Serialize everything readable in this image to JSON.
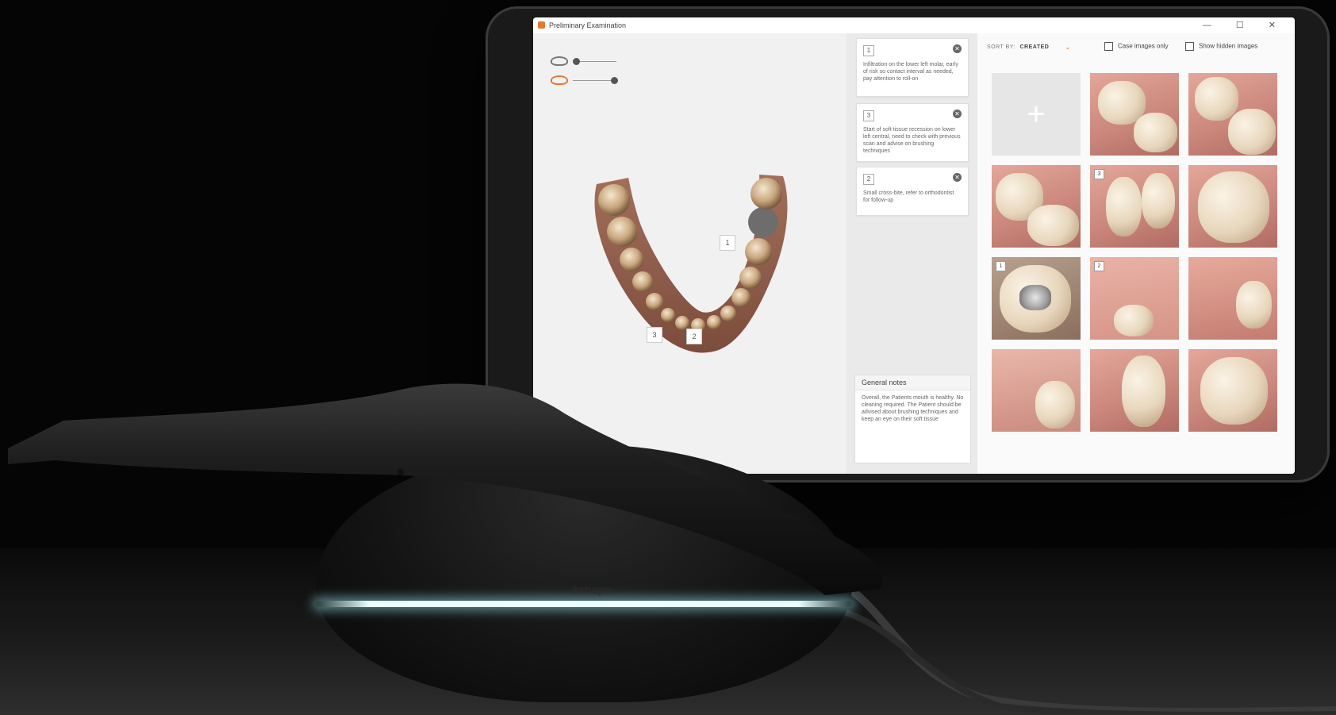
{
  "window": {
    "title": "Preliminary Examination",
    "controls": "— ☐ ✕"
  },
  "viewer": {
    "markers": [
      "1",
      "3",
      "2"
    ],
    "icons": {
      "upper": "upper-jaw-icon",
      "lower": "lower-jaw-icon"
    }
  },
  "notes": [
    {
      "number": "1",
      "text": "Infiltration on the lower left molar, early of risk so contact interval as needed, pay attention to roll-on"
    },
    {
      "number": "3",
      "text": "Start of soft tissue recession on lower left central, need to check with previous scan and advise on brushing techniques"
    },
    {
      "number": "2",
      "text": "Small cross-bite, refer to orthodontist for follow-up"
    }
  ],
  "general_notes": {
    "title": "General notes",
    "text": "Overall, the Patients mouth is healthy. No cleaning required. The Patient should be advised about brushing techniques and keep an eye on their soft tissue"
  },
  "gallery": {
    "sort_label": "SORT BY:",
    "sort_value": "CREATED",
    "case_images_only": "Case images only",
    "show_hidden_images": "Show hidden images",
    "tile_labels": [
      "3",
      "1",
      "2"
    ]
  },
  "device": {
    "logo": "3shape"
  },
  "colors": {
    "accent": "#e07b39",
    "scanner_light": "#e8ffff",
    "background": "#050505"
  }
}
